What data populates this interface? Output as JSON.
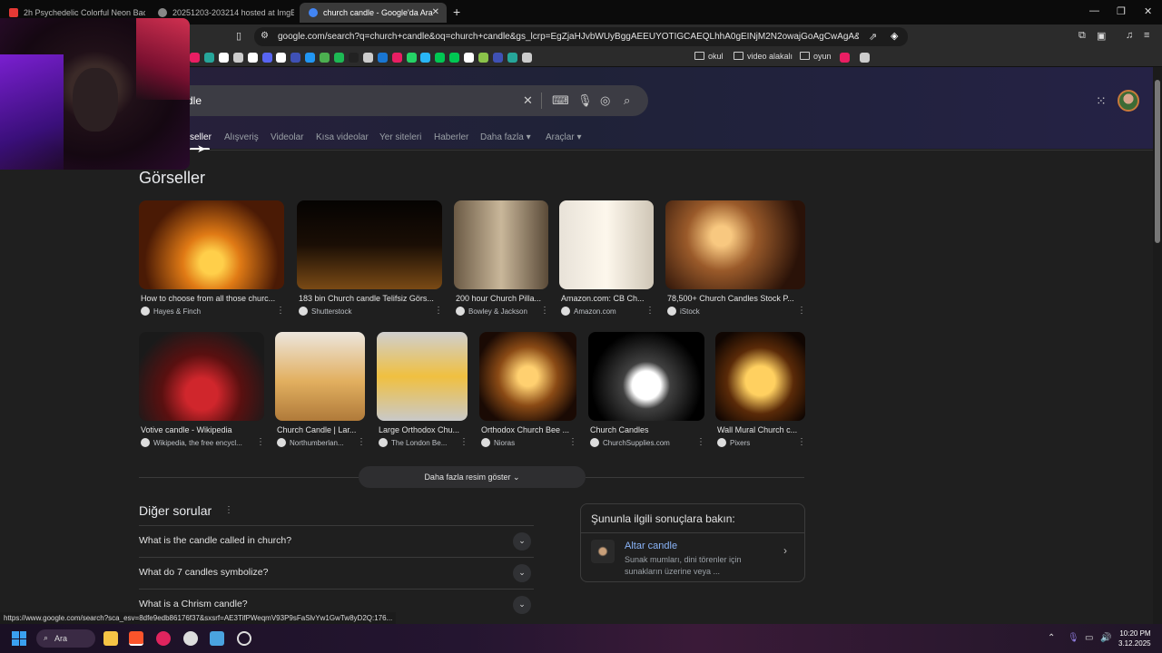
{
  "tabs": [
    {
      "title": "2h Psychedelic Colorful Neon Backg",
      "color": "#e53935"
    },
    {
      "title": "20251203-203214 hosted at ImgBB",
      "color": "#888888"
    },
    {
      "title": "church candle - Google'da Ara",
      "color": "#4285f4"
    }
  ],
  "toolbar": {
    "url": "google.com/search?q=church+candle&oq=church+candle&gs_lcrp=EgZjaHJvbWUyBggAEEUYOTIGCAEQLhhA0gEINjM2N2owajGoAgCwAgA&sourceid=c..."
  },
  "bookmarks": {
    "folders": [
      "okul",
      "video alakalı",
      "oyun"
    ],
    "icon_colors": [
      "#e91e63",
      "#26a69a",
      "#ffffff",
      "#cccccc",
      "#ffffff",
      "#5865f2",
      "#ffffff",
      "#3f51b5",
      "#2196f3",
      "#4caf50",
      "#1db954",
      "#222222",
      "#cccccc",
      "#1976d2",
      "#e91e63",
      "#25d366",
      "#29b6f6",
      "#00c853",
      "#00c853",
      "#ffffff",
      "#8bc34a",
      "#3f51b5",
      "#26a69a",
      "#cccccc"
    ]
  },
  "search": {
    "query": "dle"
  },
  "filters": {
    "items": [
      "seller",
      "Alışveriş",
      "Videolar",
      "Kısa videolar",
      "Yer siteleri",
      "Haberler",
      "Daha fazla",
      "Araçlar"
    ]
  },
  "images_section": {
    "heading": "Görseller",
    "row1": [
      {
        "caption": "How to choose from all those churc...",
        "source": "Hayes & Finch"
      },
      {
        "caption": "183 bin Church candle Telifsiz Görs...",
        "source": "Shutterstock"
      },
      {
        "caption": "200 hour Church Pilla...",
        "source": "Bowley & Jackson"
      },
      {
        "caption": "Amazon.com: CB Ch...",
        "source": "Amazon.com"
      },
      {
        "caption": "78,500+ Church Candles Stock P...",
        "source": "iStock"
      }
    ],
    "row2": [
      {
        "caption": "Votive candle - Wikipedia",
        "source": "Wikipedia, the free encycl..."
      },
      {
        "caption": "Church Candle | Lar...",
        "source": "Northumberlan..."
      },
      {
        "caption": "Large Orthodox Chu...",
        "source": "The London Be..."
      },
      {
        "caption": "Orthodox Church Bee ...",
        "source": "Nioras"
      },
      {
        "caption": "Church Candles",
        "source": "ChurchSupplies.com"
      },
      {
        "caption": "Wall Mural Church c...",
        "source": "Pixers"
      }
    ],
    "more_button": "Daha fazla resim göster"
  },
  "questions": {
    "heading": "Diğer sorular",
    "items": [
      "What is the candle called in church?",
      "What do 7 candles symbolize?",
      "What is a Chrism candle?"
    ]
  },
  "related": {
    "heading": "Şununla ilgili sonuçlara bakın:",
    "title": "Altar candle",
    "description": "Sunak mumları, dini törenler için sunakların üzerine veya ..."
  },
  "status_url": "https://www.google.com/search?sca_esv=8dfe9edb86176f37&sxsrf=AE3TifPWeqmV93P9sFaSlvYw1GwTw8yD2Q:176...",
  "taskbar": {
    "search_label": "Ara",
    "time": "10:20 PM",
    "date": "3.12.2025"
  }
}
